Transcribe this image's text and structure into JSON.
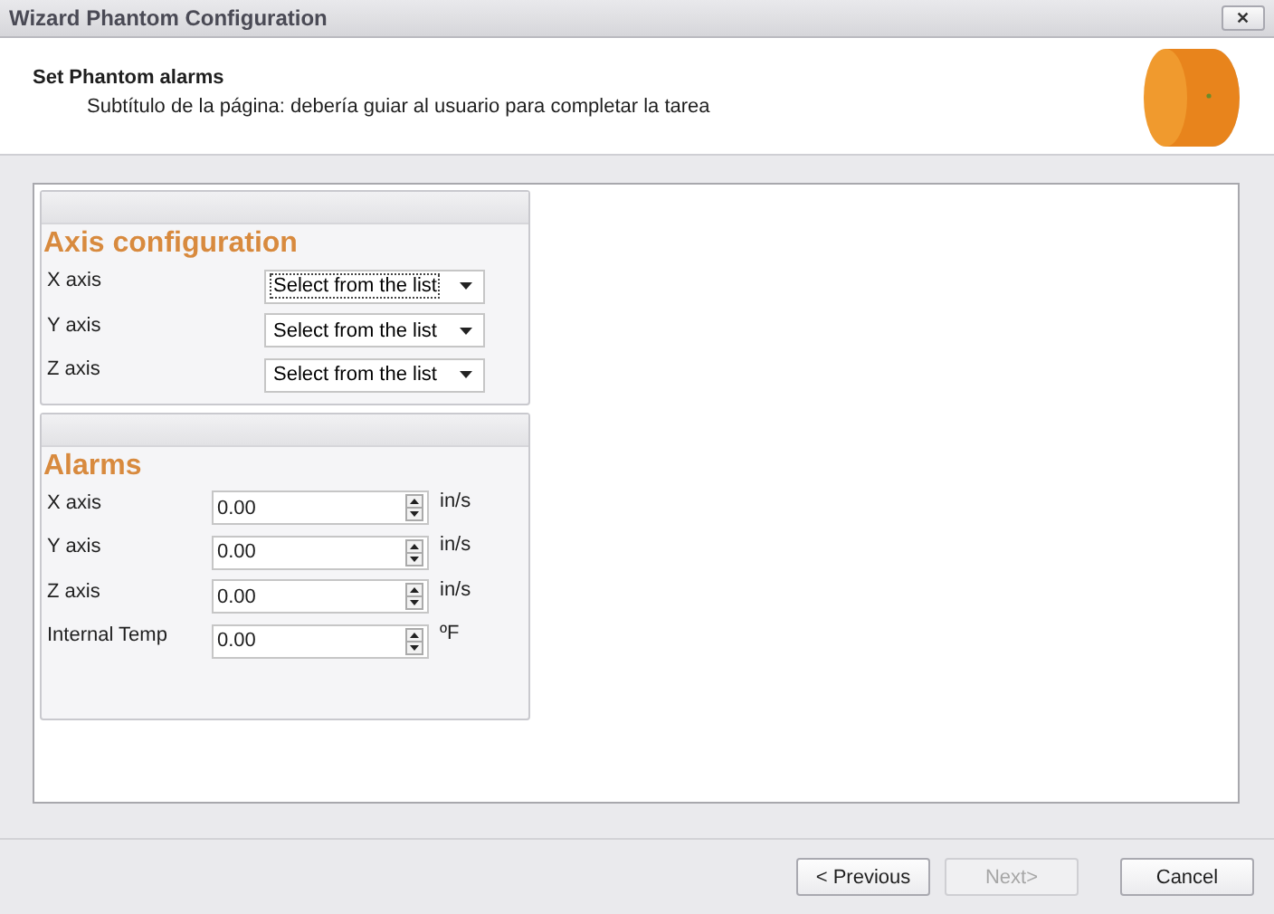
{
  "window": {
    "title": "Wizard Phantom Configuration",
    "close": "✕"
  },
  "header": {
    "title": "Set Phantom alarms",
    "subtitle": "Subtítulo de la página: debería guiar al usuario para completar la tarea"
  },
  "groups": [
    {
      "title": "Axis configuration",
      "kind": "combos",
      "rows": [
        {
          "label": "X axis",
          "value": "Select from the list",
          "focused": true
        },
        {
          "label": "Y axis",
          "value": "Select from the list",
          "focused": false
        },
        {
          "label": "Z axis",
          "value": "Select from the list",
          "focused": false
        }
      ]
    },
    {
      "title": "Alarms",
      "kind": "spins",
      "rows": [
        {
          "label": "X axis",
          "value": "0.00",
          "unit": "in/s"
        },
        {
          "label": "Y axis",
          "value": "0.00",
          "unit": "in/s"
        },
        {
          "label": "Z axis",
          "value": "0.00",
          "unit": "in/s"
        },
        {
          "label": "Internal Temp",
          "value": "0.00",
          "unit": "ºF"
        }
      ]
    }
  ],
  "buttons": [
    {
      "label": "< Previous",
      "disabled": false
    },
    {
      "label": "Next>",
      "disabled": true
    },
    {
      "label": "Cancel",
      "disabled": false
    }
  ]
}
